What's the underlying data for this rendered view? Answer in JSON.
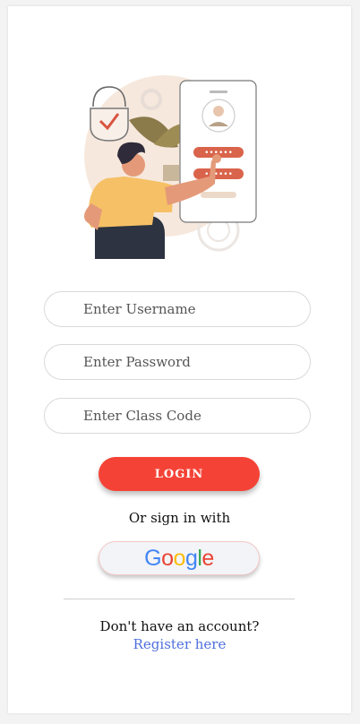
{
  "form": {
    "username_placeholder": "Enter Username",
    "password_placeholder": "Enter Password",
    "class_code_placeholder": "Enter Class Code"
  },
  "buttons": {
    "login_label": "LOGIN",
    "google_label": "Google"
  },
  "text": {
    "or_sign_in": "Or sign in with",
    "no_account": "Don't have an account?",
    "register_link": "Register here"
  },
  "colors": {
    "accent": "#f44336",
    "link": "#4f6fdc",
    "google_blue": "#4285F4",
    "google_red": "#EA4335",
    "google_yellow": "#FBBC05",
    "google_green": "#34A853"
  },
  "icons": [
    "lock-check-icon",
    "phone-profile-icon",
    "gear-icon",
    "leaf-icon"
  ]
}
